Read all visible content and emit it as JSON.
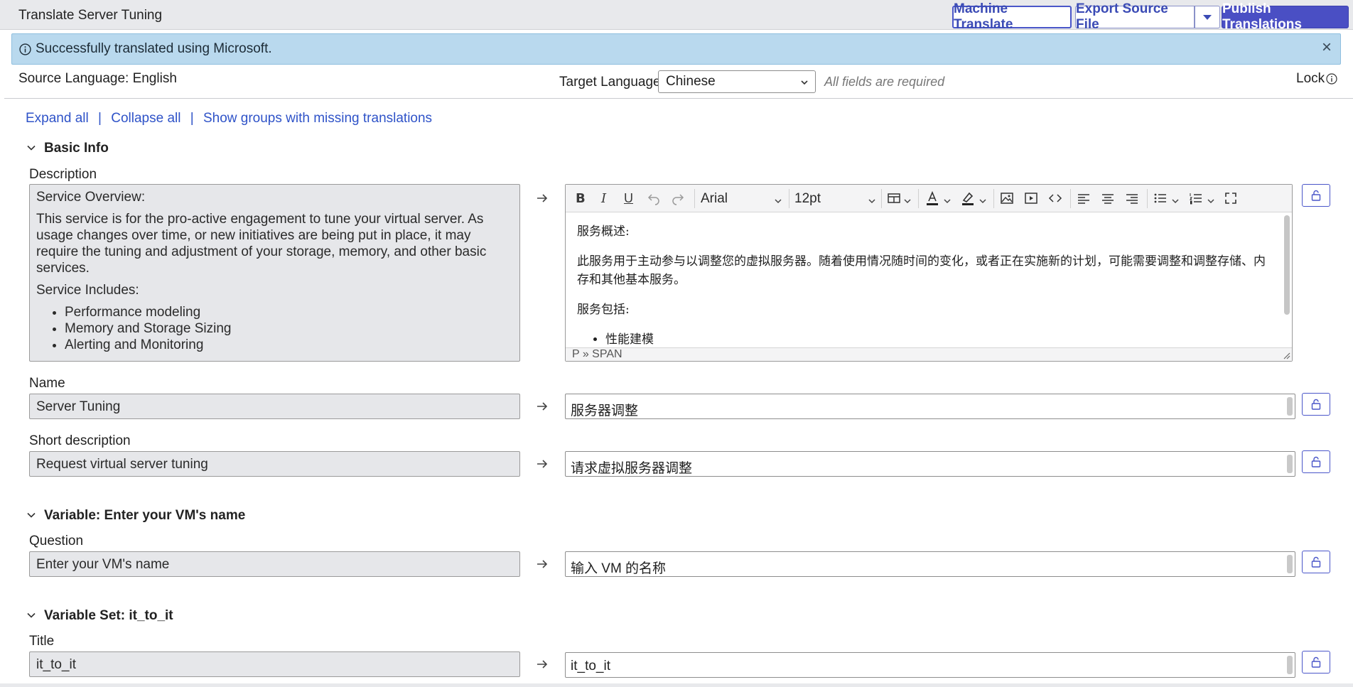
{
  "header": {
    "title": "Translate Server Tuning",
    "machine_translate": "Machine Translate",
    "export_source_file": "Export Source File",
    "publish_translations": "Publish Translations"
  },
  "alert": {
    "message": "Successfully translated using Microsoft.",
    "close": "×"
  },
  "language": {
    "source": "Source Language: English",
    "target_label": "Target Language:",
    "target_value": "Chinese",
    "required_note": "All fields are required",
    "lock": "Lock"
  },
  "links": {
    "expand_all": "Expand all",
    "collapse_all": "Collapse all",
    "show_missing": "Show groups with missing translations",
    "separator": "|"
  },
  "sections": {
    "basic_info": {
      "title": "Basic Info",
      "description": {
        "label": "Description",
        "source": {
          "heading": "Service Overview:",
          "paragraph": "This service is for the pro-active engagement to tune your virtual server. As usage changes over time, or new initiatives are being put in place, it may require the tuning and adjustment of your storage, memory, and other basic services.",
          "includes": "Service Includes:",
          "items": [
            "Performance modeling",
            "Memory and Storage Sizing",
            "Alerting and Monitoring"
          ]
        },
        "editor": {
          "font": "Arial",
          "size": "12pt",
          "heading": "服务概述:",
          "paragraph": "此服务用于主动参与以调整您的虚拟服务器。随着使用情况随时间的变化，或者正在实施新的计划，可能需要调整和调整存储、内存和其他基本服务。",
          "includes": "服务包括:",
          "items": [
            "性能建模"
          ],
          "status": "P » SPAN"
        }
      },
      "name": {
        "label": "Name",
        "source": "Server Tuning",
        "target": "服务器调整"
      },
      "short_description": {
        "label": "Short description",
        "source": "Request virtual server tuning",
        "target": "请求虚拟服务器调整"
      }
    },
    "variable_vm": {
      "title": "Variable: Enter your VM's name",
      "question": {
        "label": "Question",
        "source": "Enter your VM's name",
        "target": "输入 VM 的名称"
      }
    },
    "variable_set": {
      "title": "Variable Set: it_to_it",
      "title_field": {
        "label": "Title",
        "source": "it_to_it",
        "target": "it_to_it"
      }
    }
  },
  "colors": {
    "accent": "#4a4fc4",
    "link": "#2f53c8",
    "alert_bg": "#b9d9ee",
    "source_bg": "#e6e7ea"
  }
}
